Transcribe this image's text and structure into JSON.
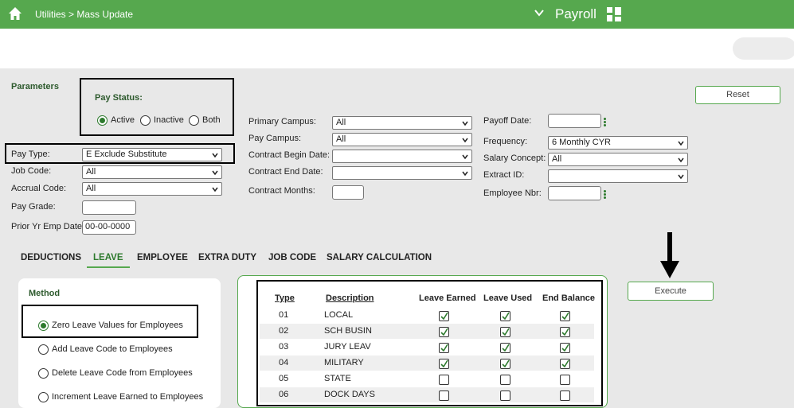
{
  "header": {
    "breadcrumb": "Utilities > Mass Update",
    "app_name": "Payroll",
    "home_icon": "home-icon",
    "menu_icon": "grid-menu-icon"
  },
  "parameters": {
    "title": "Parameters",
    "pay_status": {
      "label": "Pay Status:",
      "options": [
        "Active",
        "Inactive",
        "Both"
      ],
      "selected": "Active"
    },
    "pay_type": {
      "label": "Pay Type:",
      "value": "E Exclude Substitute"
    },
    "job_code": {
      "label": "Job Code:",
      "value": "All"
    },
    "accrual_code": {
      "label": "Accrual Code:",
      "value": "All"
    },
    "pay_grade": {
      "label": "Pay Grade:",
      "value": ""
    },
    "prior_yr_emp_date": {
      "label": "Prior Yr Emp Date:",
      "value": "00-00-0000"
    },
    "primary_campus": {
      "label": "Primary Campus:",
      "value": "All"
    },
    "pay_campus": {
      "label": "Pay Campus:",
      "value": "All"
    },
    "contract_begin_date": {
      "label": "Contract Begin Date:",
      "value": ""
    },
    "contract_end_date": {
      "label": "Contract End Date:",
      "value": ""
    },
    "contract_months": {
      "label": "Contract Months:",
      "value": ""
    },
    "payoff_date": {
      "label": "Payoff Date:",
      "value": ""
    },
    "frequency": {
      "label": "Frequency:",
      "value": "6 Monthly CYR"
    },
    "salary_concept": {
      "label": "Salary Concept:",
      "value": "All"
    },
    "extract_id": {
      "label": "Extract ID:",
      "value": ""
    },
    "employee_nbr": {
      "label": "Employee Nbr:",
      "value": ""
    },
    "reset_label": "Reset"
  },
  "tabs": [
    "DEDUCTIONS",
    "LEAVE",
    "EMPLOYEE",
    "EXTRA DUTY",
    "JOB CODE",
    "SALARY CALCULATION"
  ],
  "active_tab": "LEAVE",
  "method": {
    "title": "Method",
    "options": [
      "Zero Leave Values for Employees",
      "Add Leave Code to Employees",
      "Delete Leave Code from Employees",
      "Increment Leave Earned to Employees"
    ],
    "selected": "Zero Leave Values for Employees"
  },
  "leave_table": {
    "headers": [
      "Type",
      "Description",
      "Leave Earned",
      "Leave Used",
      "End Balance"
    ],
    "rows": [
      {
        "type": "01",
        "description": "LOCAL",
        "earned": true,
        "used": true,
        "balance": true
      },
      {
        "type": "02",
        "description": "SCH BUSIN",
        "earned": true,
        "used": true,
        "balance": true
      },
      {
        "type": "03",
        "description": "JURY LEAV",
        "earned": true,
        "used": true,
        "balance": true
      },
      {
        "type": "04",
        "description": "MILITARY",
        "earned": true,
        "used": true,
        "balance": true
      },
      {
        "type": "05",
        "description": "STATE",
        "earned": false,
        "used": false,
        "balance": false
      },
      {
        "type": "06",
        "description": "DOCK DAYS",
        "earned": false,
        "used": false,
        "balance": false
      }
    ]
  },
  "execute_label": "Execute",
  "colors": {
    "brand_green": "#56a84e",
    "dark_green": "#2d7a2d"
  }
}
